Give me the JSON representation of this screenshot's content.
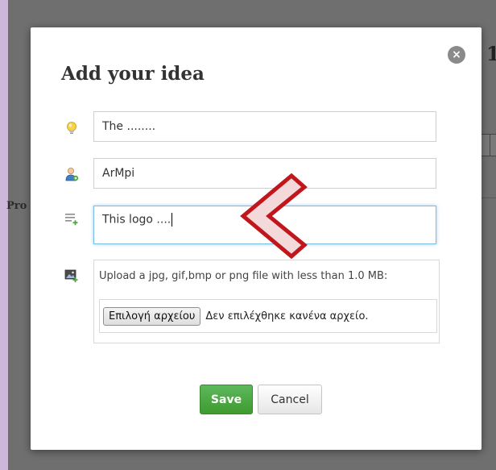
{
  "background": {
    "peek_number": "1",
    "peek_label": "Pro"
  },
  "modal": {
    "title": "Add your idea",
    "close_label": "×",
    "fields": {
      "title_value": "The ........",
      "author_value": "ArMpi",
      "description_value": "This logo ...."
    },
    "upload": {
      "hint": "Upload a jpg, gif,bmp or png file with less than 1.0 MB:",
      "choose_button": "Επιλογή αρχείου",
      "no_file_status": "Δεν επιλέχθηκε κανένα αρχείο."
    },
    "buttons": {
      "save": "Save",
      "cancel": "Cancel"
    }
  },
  "icons": {
    "title_field": "lightbulb-icon",
    "author_field": "user-icon",
    "description_field": "text-lines-add-icon",
    "upload_field": "image-add-icon",
    "close": "close-icon",
    "annotation": "chevron-left-arrow"
  },
  "colors": {
    "overlay": "#6f6f6f",
    "side_strip": "#cdb8dc",
    "save_green": "#4cae3c",
    "focus_border": "#7bbfe0",
    "annotation_red": "#c0161c",
    "annotation_fill": "#f4d9da"
  }
}
